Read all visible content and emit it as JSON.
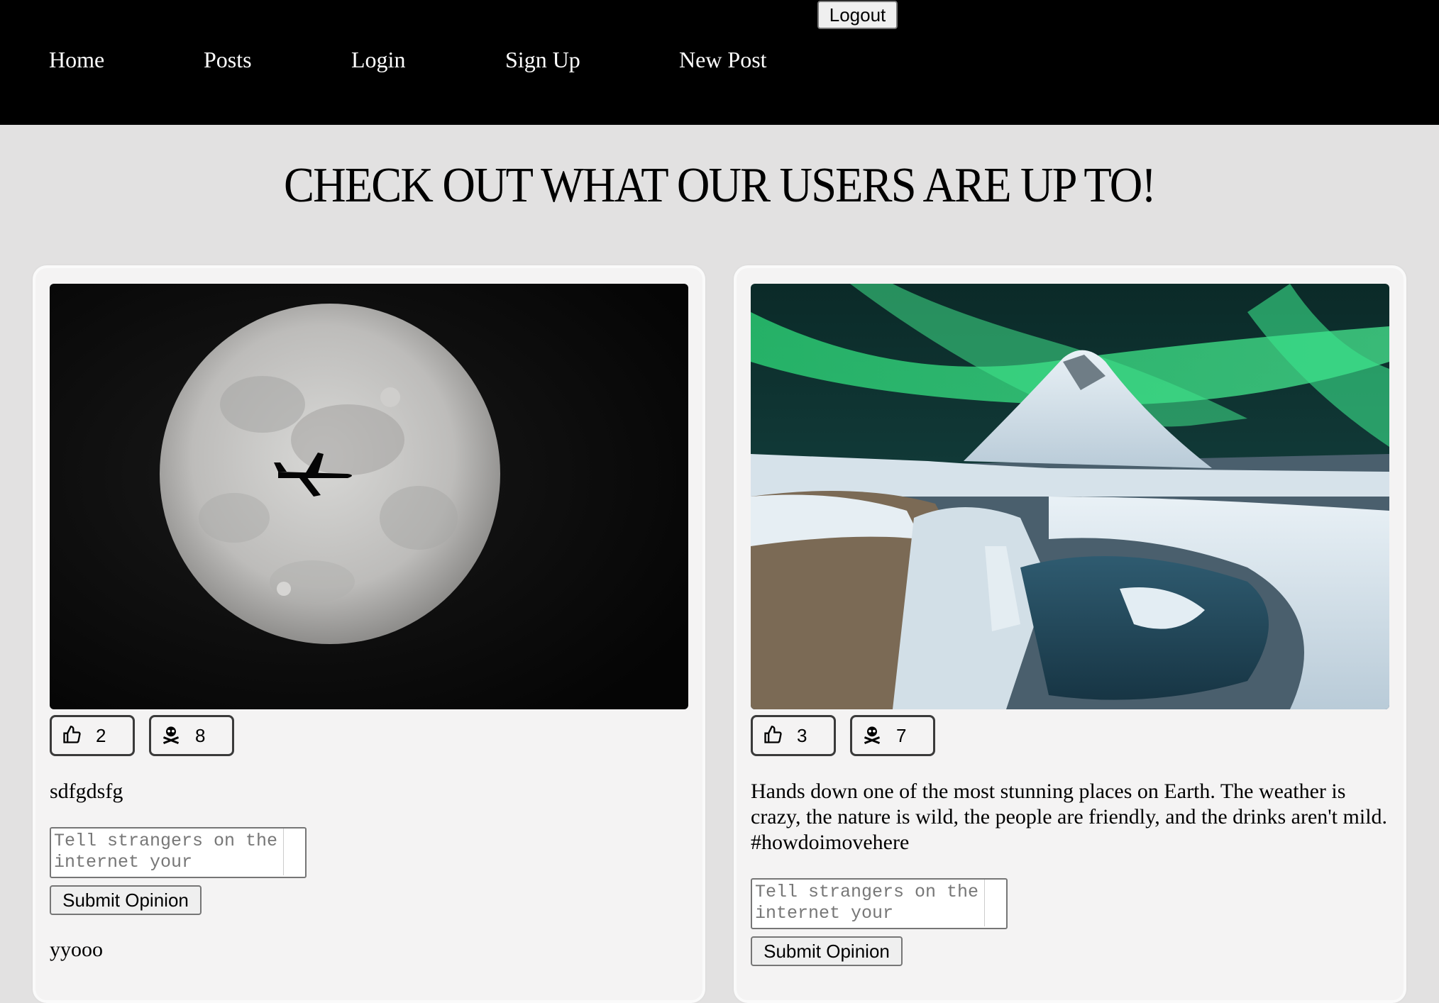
{
  "header": {
    "logout_label": "Logout",
    "nav": [
      {
        "label": "Home"
      },
      {
        "label": "Posts"
      },
      {
        "label": "Login"
      },
      {
        "label": "Sign Up"
      },
      {
        "label": "New Post"
      }
    ]
  },
  "main": {
    "headline": "CHECK OUT WHAT OUR USERS ARE UP TO!"
  },
  "posts": [
    {
      "image_subject": "full moon with airplane silhouette",
      "likes": "2",
      "dislikes": "8",
      "caption": "sdfgdsfg",
      "opinion_placeholder": "Tell strangers on the internet your",
      "submit_label": "Submit Opinion",
      "comments": [
        "yyooo"
      ]
    },
    {
      "image_subject": "northern lights over snowy mountain and waterfall",
      "likes": "3",
      "dislikes": "7",
      "caption": "Hands down one of the most stunning places on Earth. The weather is crazy, the nature is wild, the people are friendly, and the drinks aren't mild. #howdoimovehere",
      "opinion_placeholder": "Tell strangers on the internet your",
      "submit_label": "Submit Opinion",
      "comments": []
    }
  ],
  "icons": {
    "like": "thumbs-up-icon",
    "dislike": "skull-crossbones-icon"
  },
  "colors": {
    "topbar": "#000000",
    "page_bg": "#e2e1e1",
    "card_bg": "#f4f3f3"
  }
}
